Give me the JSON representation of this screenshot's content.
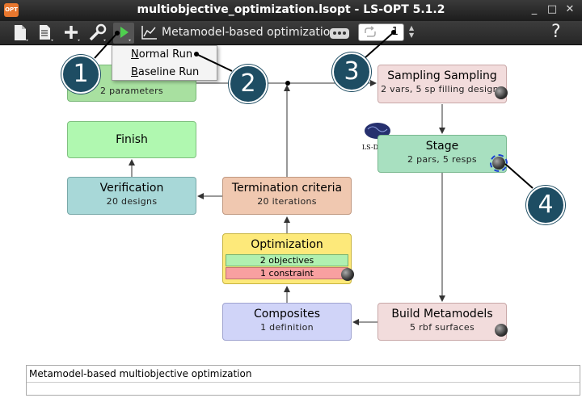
{
  "window": {
    "title": "multiobjective_optimization.lsopt - LS-OPT 5.1.2",
    "app_icon": "OPT",
    "minimize": "_",
    "maximize": "□",
    "close": "✕"
  },
  "toolbar": {
    "task_label": "Metamodel-based optimization",
    "iterations_value": "1",
    "help": "?"
  },
  "run_menu": {
    "items": [
      {
        "accel": "N",
        "rest": "ormal Run"
      },
      {
        "accel": "B",
        "rest": "aseline Run"
      }
    ]
  },
  "nodes": {
    "setup": {
      "subtitle": "2 parameters"
    },
    "sampling": {
      "title": "Sampling Sampling",
      "subtitle": "2 vars, 5 sp filling designs"
    },
    "stage": {
      "title": "Stage",
      "subtitle": "2 pars, 5 resps",
      "solver_logo": "LS-DYNA"
    },
    "finish": {
      "title": "Finish"
    },
    "verification": {
      "title": "Verification",
      "subtitle": "20 designs"
    },
    "termination": {
      "title": "Termination criteria",
      "subtitle": "20 iterations"
    },
    "optimization": {
      "title": "Optimization",
      "objectives": "2 objectives",
      "constraints": "1 constraint"
    },
    "composites": {
      "title": "Composites",
      "subtitle": "1 definition"
    },
    "metamodels": {
      "title": "Build Metamodels",
      "subtitle": "5 rbf surfaces"
    }
  },
  "callouts": [
    "1",
    "2",
    "3",
    "4"
  ],
  "status": {
    "text": "Metamodel-based multiobjective optimization"
  },
  "colors": {
    "green_node": "#a8e0a0",
    "pink_node": "#f2dcdc",
    "teal_node": "#a8d8d8",
    "peach_node": "#f0c8b0",
    "yellow_node": "#fde97a",
    "lavender_node": "#d0d4f8",
    "callout": "#1e4d63"
  },
  "icons": [
    "new-file-icon",
    "open-file-icon",
    "add-icon",
    "wrench-icon",
    "run-icon",
    "chart-icon",
    "more-icon",
    "loop-icon",
    "help-icon"
  ]
}
